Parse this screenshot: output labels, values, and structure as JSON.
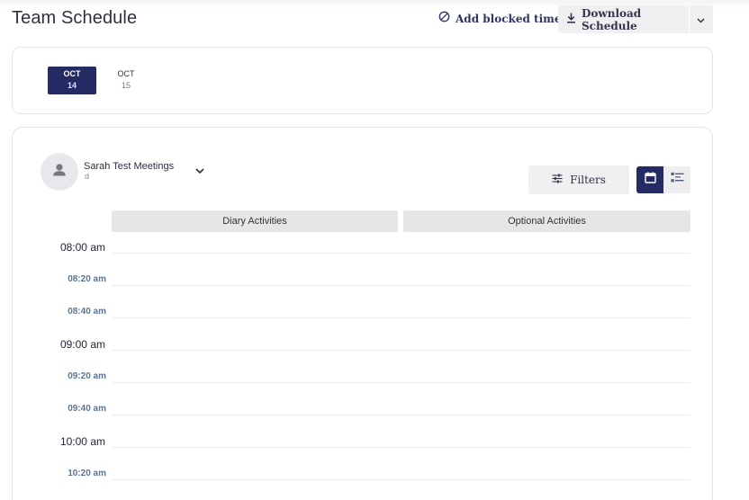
{
  "page": {
    "title": "Team Schedule"
  },
  "header": {
    "add_blocked_time_label": "Add blocked time",
    "download_schedule_label": "Download Schedule"
  },
  "dates": [
    {
      "month": "OCT",
      "day": "14",
      "active": true
    },
    {
      "month": "OCT",
      "day": "15",
      "active": false
    }
  ],
  "person": {
    "name": "Sarah Test Meetings",
    "subtitle": "d"
  },
  "toolbar": {
    "filters_label": "Filters",
    "active_view": "calendar"
  },
  "columns": [
    "Diary Activities",
    "Optional Activities"
  ],
  "time_slots": [
    {
      "label": "08:00 am",
      "major": true
    },
    {
      "label": "08:20 am",
      "major": false
    },
    {
      "label": "08:40 am",
      "major": false
    },
    {
      "label": "09:00 am",
      "major": true
    },
    {
      "label": "09:20 am",
      "major": false
    },
    {
      "label": "09:40 am",
      "major": false
    },
    {
      "label": "10:00 am",
      "major": true
    },
    {
      "label": "10:20 am",
      "major": false
    }
  ],
  "colors": {
    "accent": "#242a63",
    "minor_time": "#5d7591",
    "button_bg": "#f0f0f2"
  },
  "icons": {
    "blocked": "ban-icon",
    "download": "download-icon",
    "caret": "chevron-down-icon",
    "avatar": "person-icon",
    "filters": "sliders-icon",
    "calendar_view": "calendar-icon",
    "list_view": "list-icon"
  }
}
